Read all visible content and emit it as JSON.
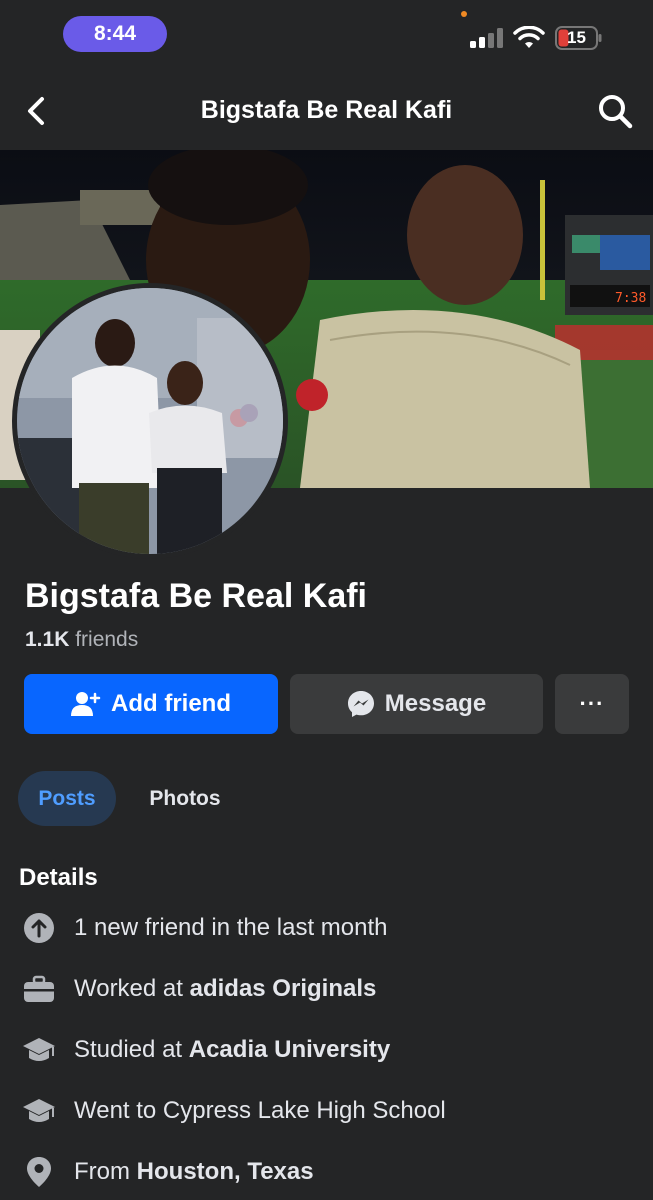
{
  "status_bar": {
    "time": "8:44",
    "battery": "15"
  },
  "header": {
    "title": "Bigstafa Be Real Kafi"
  },
  "profile": {
    "name": "Bigstafa Be Real Kafi",
    "friends_count": "1.1K",
    "friends_label": "friends"
  },
  "actions": {
    "add_friend": "Add friend",
    "message": "Message",
    "more": "···"
  },
  "tabs": [
    {
      "label": "Posts",
      "active": true
    },
    {
      "label": "Photos",
      "active": false
    }
  ],
  "details": {
    "title": "Details",
    "items": [
      {
        "icon": "arrow-up-circle-icon",
        "prefix": "1 new friend in the last month",
        "bold": ""
      },
      {
        "icon": "briefcase-icon",
        "prefix": "Worked at ",
        "bold": "adidas Originals"
      },
      {
        "icon": "graduation-cap-icon",
        "prefix": "Studied at ",
        "bold": "Acadia University"
      },
      {
        "icon": "graduation-cap-icon",
        "prefix": "Went to Cypress Lake High School",
        "bold": ""
      },
      {
        "icon": "location-pin-icon",
        "prefix": "From ",
        "bold": "Houston, Texas"
      }
    ]
  },
  "colors": {
    "background": "#242526",
    "primary_button": "#0866ff",
    "secondary_button": "#3a3b3c",
    "active_tab_bg": "#263951",
    "active_tab_text": "#4f9dff",
    "time_pill": "#6a5be8",
    "battery_low": "#e0403a"
  }
}
